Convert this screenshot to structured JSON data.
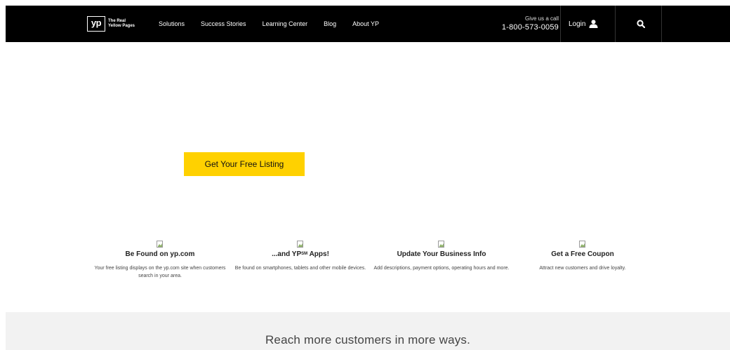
{
  "header": {
    "logo": {
      "mark": "yp",
      "tagline": "The Real Yellow Pages"
    },
    "nav": [
      {
        "label": "Solutions"
      },
      {
        "label": "Success Stories"
      },
      {
        "label": "Learning Center"
      },
      {
        "label": "Blog"
      },
      {
        "label": "About YP"
      }
    ],
    "call": {
      "label": "Give us a call",
      "number": "1-800-573-0059"
    },
    "login_label": "Login",
    "icons": {
      "login": "user-icon",
      "search": "search-icon"
    }
  },
  "hero": {
    "cta_label": "Get Your Free Listing",
    "cta_color": "#ffd100"
  },
  "features": [
    {
      "title": "Be Found on yp.com",
      "desc": "Your free listing displays on the yp.com site when customers search in your area."
    },
    {
      "title_pre": "...and YP",
      "title_sup": "SM",
      "title_post": " Apps!",
      "desc": "Be found on smartphones, tablets and other mobile devices."
    },
    {
      "title": "Update Your Business Info",
      "desc": "Add descriptions, payment options, operating hours and more."
    },
    {
      "title": "Get a Free Coupon",
      "desc": "Attract new customers and drive loyalty."
    }
  ],
  "band": {
    "text": "Reach more customers in more ways."
  }
}
